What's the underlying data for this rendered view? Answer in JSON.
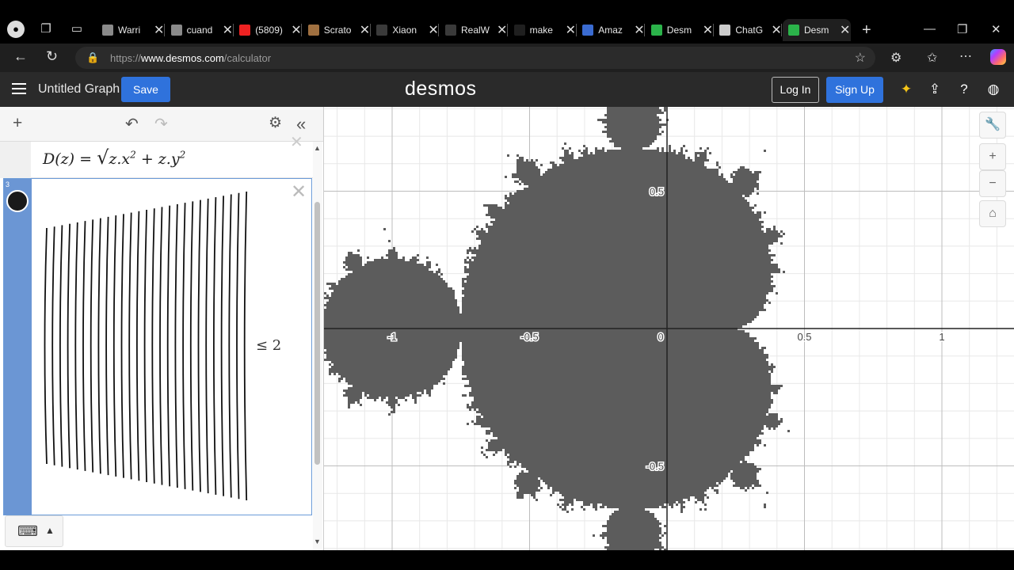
{
  "browser": {
    "tabs": [
      {
        "title": "Warri",
        "favicon_color": "#8a8a8a"
      },
      {
        "title": "cuand",
        "favicon_color": "#8a8a8a"
      },
      {
        "title": "(5809)",
        "favicon_color": "#e22"
      },
      {
        "title": "Scrato",
        "favicon_color": "#a07040"
      },
      {
        "title": "Xiaon",
        "favicon_color": "#3a3a3a"
      },
      {
        "title": "RealW",
        "favicon_color": "#3a3a3a"
      },
      {
        "title": "make",
        "favicon_color": "#1f1f1f"
      },
      {
        "title": "Amaz",
        "favicon_color": "#3a6bd1"
      },
      {
        "title": "Desm",
        "favicon_color": "#2bb34a"
      },
      {
        "title": "ChatG",
        "favicon_color": "#cccccc"
      },
      {
        "title": "Desm",
        "favicon_color": "#2bb34a",
        "active": true
      }
    ],
    "url_scheme": "https://",
    "url_host": "www.desmos.com",
    "url_path": "/calculator"
  },
  "desmos": {
    "graph_title": "Untitled Graph",
    "save_label": "Save",
    "brand": "desmos",
    "login_label": "Log In",
    "signup_label": "Sign Up",
    "accent_color": "#2f72dc"
  },
  "expressions": {
    "expr1_lhs": "D(z) = ",
    "expr1_sqrt": "√",
    "expr1_body": "z.x",
    "expr1_body2": " + z.y",
    "expr1_exp": "2",
    "expr3_number": "3",
    "expr3_rhs": "≤ 2"
  },
  "graph": {
    "x_ticks": [
      "-1",
      "-0.5",
      "0",
      "0.5",
      "1"
    ],
    "y_ticks": [
      "0.5",
      "-0.5"
    ],
    "fill_color": "#5c5c5c",
    "view": {
      "x_min": -1.25,
      "x_max": 1.25,
      "y_min": -0.8,
      "y_max": 0.8
    }
  }
}
